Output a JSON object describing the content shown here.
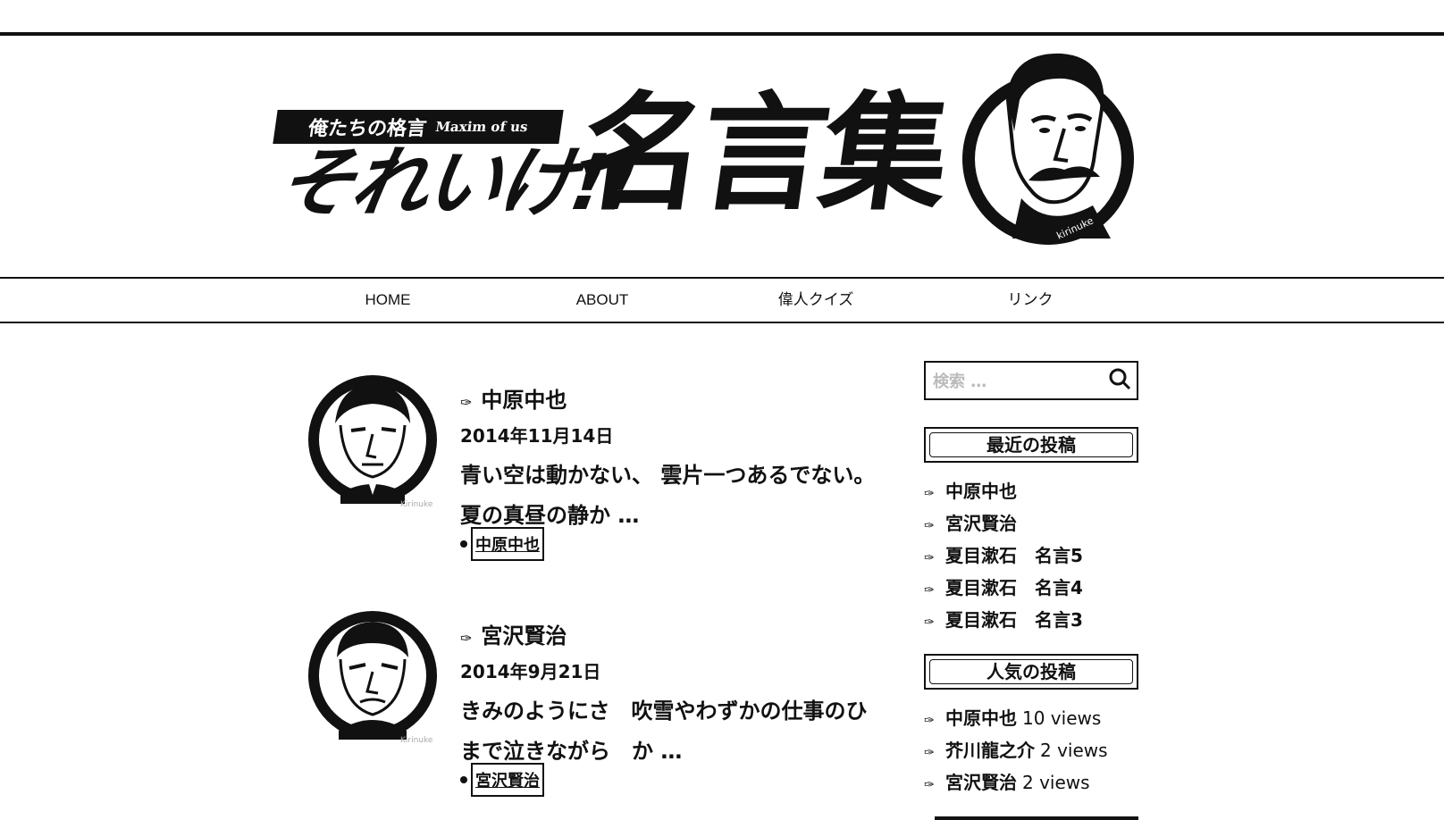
{
  "header": {
    "tagline_jp": "俺たちの格言",
    "tagline_en": "Maxim of us",
    "logo_kana": "それいけ!!",
    "logo_main": "名言集",
    "portrait_credit": "kirinuke"
  },
  "nav": {
    "items": [
      {
        "label": "HOME"
      },
      {
        "label": "ABOUT"
      },
      {
        "label": "偉人クイズ"
      },
      {
        "label": "リンク"
      }
    ]
  },
  "posts": [
    {
      "title": "中原中也",
      "date": "2014年11月14日",
      "excerpt": "青い空は動かない、 雲片一つあるでない。 夏の真昼の静か …",
      "tag": "中原中也",
      "avatar_credit": "Kirinuke"
    },
    {
      "title": "宮沢賢治",
      "date": "2014年9月21日",
      "excerpt": "きみのようにさ　吹雪やわずかの仕事のひまで泣きながら　か …",
      "tag": "宮沢賢治",
      "avatar_credit": "Kirinuke"
    }
  ],
  "sidebar": {
    "search": {
      "placeholder": "検索 …"
    },
    "recent": {
      "title": "最近の投稿",
      "items": [
        {
          "label": "中原中也"
        },
        {
          "label": "宮沢賢治"
        },
        {
          "label": "夏目漱石　名言5"
        },
        {
          "label": "夏目漱石　名言4"
        },
        {
          "label": "夏目漱石　名言3"
        }
      ]
    },
    "popular": {
      "title": "人気の投稿",
      "items": [
        {
          "label": "中原中也",
          "views": "10 views"
        },
        {
          "label": "芥川龍之介",
          "views": "2 views"
        },
        {
          "label": "宮沢賢治",
          "views": "2 views"
        }
      ]
    }
  },
  "icons": {
    "pen": "pen-nib-icon",
    "search": "search-icon",
    "tag": "tag-icon"
  }
}
